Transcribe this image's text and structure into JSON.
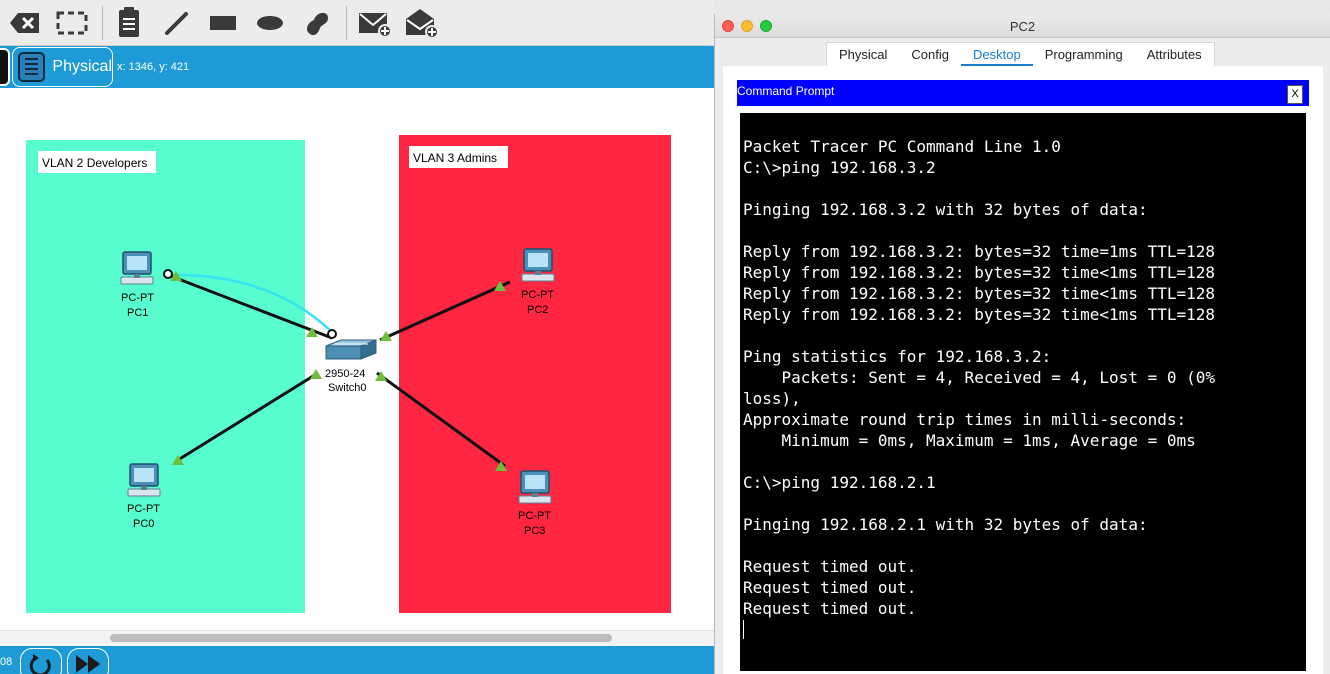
{
  "toolbar": {
    "tools": [
      "delete-tool",
      "select-tool",
      "note-tool",
      "draw-line-tool",
      "rectangle-tool",
      "ellipse-tool",
      "freeform-tool",
      "add-simple-pdu-tool",
      "add-complex-pdu-tool"
    ]
  },
  "workspace": {
    "mode_label": "Physical",
    "coordinates": "x: 1346, y: 421",
    "zones": [
      {
        "label": "VLAN 2 Developers",
        "color": "#57fdcf"
      },
      {
        "label": "VLAN 3 Admins",
        "color": "#ff2642"
      }
    ],
    "devices": {
      "pc1": {
        "type": "PC-PT",
        "name": "PC1"
      },
      "pc0": {
        "type": "PC-PT",
        "name": "PC0"
      },
      "pc2": {
        "type": "PC-PT",
        "name": "PC2"
      },
      "pc3": {
        "type": "PC-PT",
        "name": "PC3"
      },
      "switch0": {
        "type": "2950-24",
        "name": "Switch0"
      }
    }
  },
  "bottom_bar": {
    "time_fragment": "08"
  },
  "pc_window": {
    "title": "PC2",
    "tabs": [
      "Physical",
      "Config",
      "Desktop",
      "Programming",
      "Attributes"
    ],
    "active_tab": "Desktop",
    "command_prompt": {
      "title": "Command Prompt",
      "close_label": "X",
      "output": "Packet Tracer PC Command Line 1.0\nC:\\>ping 192.168.3.2\n\nPinging 192.168.3.2 with 32 bytes of data:\n\nReply from 192.168.3.2: bytes=32 time=1ms TTL=128\nReply from 192.168.3.2: bytes=32 time<1ms TTL=128\nReply from 192.168.3.2: bytes=32 time<1ms TTL=128\nReply from 192.168.3.2: bytes=32 time<1ms TTL=128\n\nPing statistics for 192.168.3.2:\n    Packets: Sent = 4, Received = 4, Lost = 0 (0%\nloss),\nApproximate round trip times in milli-seconds:\n    Minimum = 0ms, Maximum = 1ms, Average = 0ms\n\nC:\\>ping 192.168.2.1\n\nPinging 192.168.2.1 with 32 bytes of data:\n\nRequest timed out.\nRequest timed out.\nRequest timed out."
    }
  },
  "colors": {
    "accent_blue": "#1e9bd6",
    "prompt_bar": "#0000ff",
    "link_port": "#6fbd3c"
  }
}
